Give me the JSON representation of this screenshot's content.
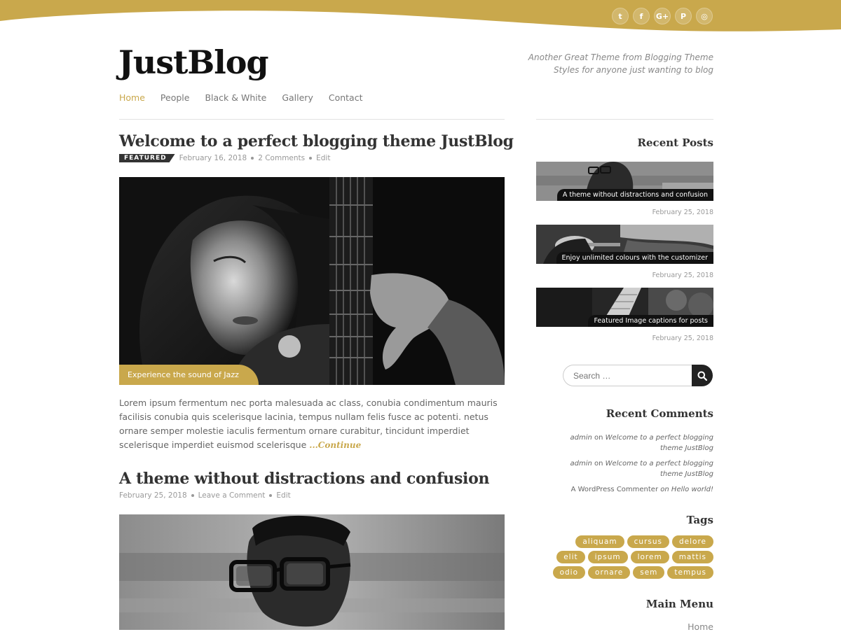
{
  "colors": {
    "accent": "#c9a84c",
    "dark": "#222222"
  },
  "social": [
    {
      "icon": "twitter-icon",
      "glyph": "t"
    },
    {
      "icon": "facebook-icon",
      "glyph": "f"
    },
    {
      "icon": "google-plus-icon",
      "glyph": "G+"
    },
    {
      "icon": "pinterest-icon",
      "glyph": "P"
    },
    {
      "icon": "instagram-icon",
      "glyph": "◎"
    }
  ],
  "site": {
    "title": "JustBlog",
    "tagline_line1": "Another Great Theme from Blogging Theme",
    "tagline_line2": "Styles for anyone just wanting to blog"
  },
  "nav": [
    "Home",
    "People",
    "Black & White",
    "Gallery",
    "Contact"
  ],
  "posts": [
    {
      "title": "Welcome to a perfect blogging theme JustBlog",
      "badge": "FEATURED",
      "date": "February 16, 2018",
      "comments": "2 Comments",
      "edit": "Edit",
      "image_caption": "Experience the sound of Jazz",
      "excerpt": "Lorem ipsum fermentum nec porta malesuada ac class, conubia condimentum mauris facilisis conubia quis scelerisque lacinia, tempus nullam felis fusce ac potenti. netus ornare semper molestie iaculis fermentum ornare curabitur, tincidunt imperdiet scelerisque imperdiet euismod scelerisque ",
      "more": "...Continue"
    },
    {
      "title": "A theme without distractions and confusion",
      "date": "February 25, 2018",
      "comments": "Leave a Comment",
      "edit": "Edit"
    }
  ],
  "sidebar": {
    "recent_posts_title": "Recent Posts",
    "recent_posts": [
      {
        "caption": "A theme without distractions and confusion",
        "date": "February 25, 2018"
      },
      {
        "caption": "Enjoy unlimited colours with the customizer",
        "date": "February 25, 2018"
      },
      {
        "caption": "Featured Image captions for posts",
        "date": "February 25, 2018"
      }
    ],
    "search_placeholder": "Search …",
    "recent_comments_title": "Recent Comments",
    "recent_comments": [
      {
        "author": "admin",
        "on": "on",
        "post": "Welcome to a perfect blogging theme JustBlog"
      },
      {
        "author": "admin",
        "on": "on",
        "post": "Welcome to a perfect blogging theme JustBlog"
      },
      {
        "author": "A WordPress Commenter",
        "on": "on",
        "post": "Hello world!"
      }
    ],
    "tags_title": "Tags",
    "tags": [
      "aliquam",
      "cursus",
      "delore",
      "elit",
      "ipsum",
      "lorem",
      "mattis",
      "odio",
      "ornare",
      "sem",
      "tempus"
    ],
    "main_menu_title": "Main Menu",
    "main_menu_first": "Home"
  }
}
